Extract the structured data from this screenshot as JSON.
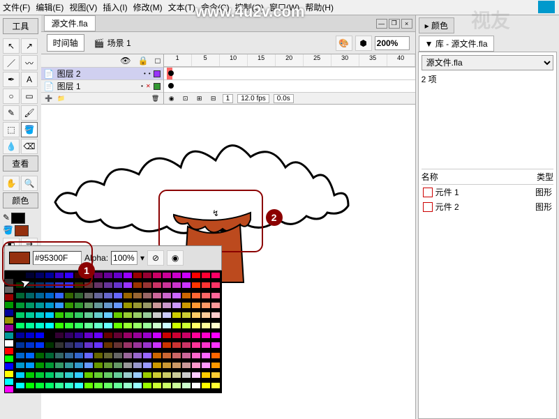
{
  "menu": {
    "file": "文件(F)",
    "edit": "编辑(E)",
    "view": "视图(V)",
    "insert": "插入(I)",
    "modify": "修改(M)",
    "text": "文本(T)",
    "commands": "命令(C)",
    "control": "控制(O)",
    "window": "窗口(W)",
    "help": "帮助(H)"
  },
  "watermark": "www.4u2v.com",
  "watermark2": "视友",
  "tools": {
    "title": "工具",
    "view_title": "查看",
    "color_title": "颜色",
    "stroke_color": "#000000",
    "fill_color": "#95300F"
  },
  "doc": {
    "tab": "源文件.fla",
    "timeline_btn": "时间轴",
    "scene": "场景 1",
    "zoom": "200%"
  },
  "timeline": {
    "ruler": [
      "1",
      "5",
      "10",
      "15",
      "20",
      "25",
      "30",
      "35",
      "40"
    ],
    "eye": "👁",
    "lock": "🔒",
    "out": "□",
    "layers": [
      {
        "name": "图层 2"
      },
      {
        "name": "图层 1"
      }
    ],
    "frame": "1",
    "fps": "12.0 fps",
    "time": "0.0s"
  },
  "panels": {
    "color_tab": "▸ 颜色",
    "lib_tab": "▼ 库 - 源文件.fla",
    "lib_file": "源文件.fla",
    "lib_count": "2 项",
    "name_col": "名称",
    "type_col": "类型",
    "items": [
      {
        "name": "元件 1",
        "type": "图形"
      },
      {
        "name": "元件 2",
        "type": "图形"
      }
    ]
  },
  "picker": {
    "hex": "#95300F",
    "alpha_label": "Alpha:",
    "alpha": "100%",
    "swatch_color": "#95300F"
  },
  "callouts": {
    "one": "1",
    "two": "2"
  }
}
